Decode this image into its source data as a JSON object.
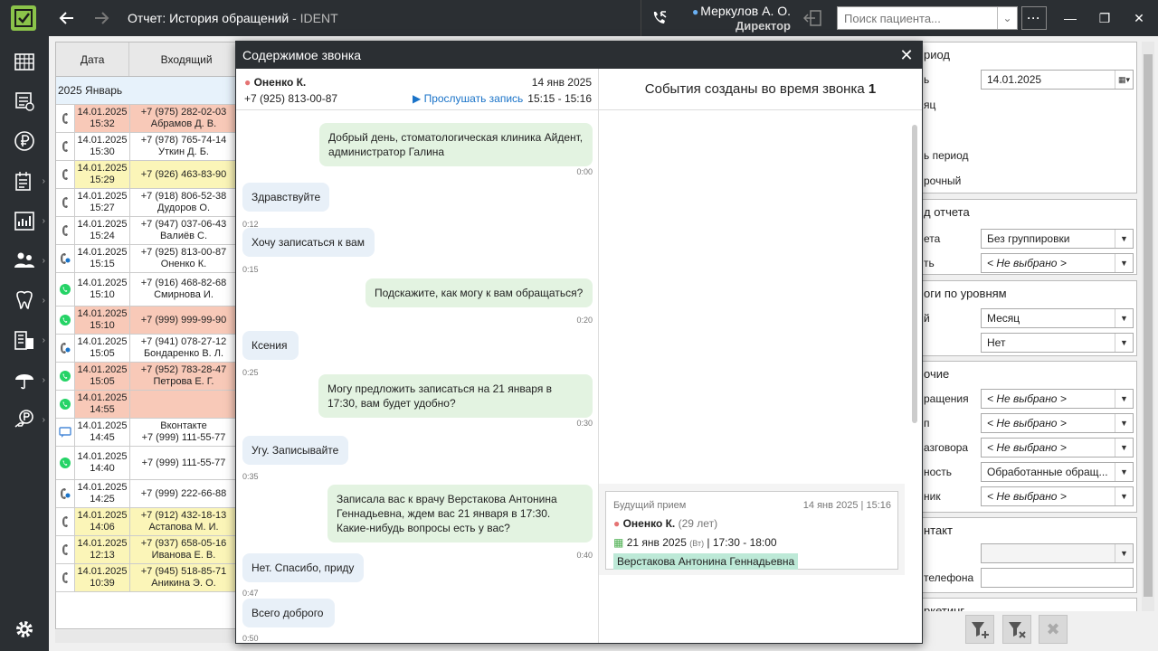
{
  "topbar": {
    "title": "Отчет: История обращений",
    "app_name": " - IDENT",
    "user_name": "Меркулов А. О.",
    "user_role": "Директор",
    "search_placeholder": "Поиск пациента...",
    "more_label": "···"
  },
  "table": {
    "col_date": "Дата",
    "col_incoming": "Входящий",
    "group_label": "2025 Январь",
    "rows": [
      {
        "date": "14.01.2025",
        "time": "15:32",
        "phone": "+7 (975) 282-02-03",
        "name": "Абрамов Д. В.",
        "status": "red",
        "icon": "phone"
      },
      {
        "date": "14.01.2025",
        "time": "15:30",
        "phone": "+7 (978) 765-74-14",
        "name": "Уткин Д. Б.",
        "status": "none",
        "icon": "phone"
      },
      {
        "date": "14.01.2025",
        "time": "15:29",
        "phone": "+7 (926) 463-83-90",
        "name": "",
        "status": "yellow",
        "icon": "phone"
      },
      {
        "date": "14.01.2025",
        "time": "15:27",
        "phone": "+7 (918) 806-52-38",
        "name": "Дудоров О.",
        "status": "none",
        "icon": "phone"
      },
      {
        "date": "14.01.2025",
        "time": "15:24",
        "phone": "+7 (947) 037-06-43",
        "name": "Валиёв С.",
        "status": "none",
        "icon": "phone"
      },
      {
        "date": "14.01.2025",
        "time": "15:15",
        "phone": "+7 (925) 813-00-87",
        "name": "Оненко К.",
        "status": "none",
        "icon": "phone-recorded"
      },
      {
        "date": "14.01.2025",
        "time": "15:10",
        "phone": "+7 (916) 468-82-68",
        "name": "Смирнова И.",
        "status": "none",
        "icon": "whatsapp"
      },
      {
        "date": "14.01.2025",
        "time": "15:10",
        "phone": "+7 (999) 999-99-90",
        "name": "",
        "status": "red",
        "icon": "whatsapp"
      },
      {
        "date": "14.01.2025",
        "time": "15:05",
        "phone": "+7 (941) 078-27-12",
        "name": "Бондаренко В. Л.",
        "status": "none",
        "icon": "phone-recorded"
      },
      {
        "date": "14.01.2025",
        "time": "15:05",
        "phone": "+7 (952) 783-28-47",
        "name": "Петрова Е. Г.",
        "status": "red",
        "icon": "whatsapp"
      },
      {
        "date": "14.01.2025",
        "time": "14:55",
        "phone": "",
        "name": "",
        "status": "red",
        "icon": "whatsapp"
      },
      {
        "date": "14.01.2025",
        "time": "14:45",
        "phone": "Вконтакте",
        "name": "+7 (999) 111-55-77",
        "status": "none",
        "icon": "chat"
      },
      {
        "date": "14.01.2025",
        "time": "14:40",
        "phone": "+7 (999) 111-55-77",
        "name": "",
        "status": "none",
        "icon": "whatsapp"
      },
      {
        "date": "14.01.2025",
        "time": "14:25",
        "phone": "+7 (999) 222-66-88",
        "name": "",
        "status": "none",
        "icon": "phone-recorded"
      },
      {
        "date": "14.01.2025",
        "time": "14:06",
        "phone": "+7 (912) 432-18-13",
        "name": "Астапова М. И.",
        "status": "yellow",
        "icon": "phone"
      },
      {
        "date": "14.01.2025",
        "time": "12:13",
        "phone": "+7 (937) 658-05-16",
        "name": "Иванова Е. В.",
        "status": "yellow",
        "icon": "phone"
      },
      {
        "date": "14.01.2025",
        "time": "10:39",
        "phone": "+7 (945) 518-85-71",
        "name": "Аникина Э. О.",
        "status": "yellow",
        "icon": "phone"
      }
    ]
  },
  "filters": {
    "period_header": "риод",
    "period_label": "ь",
    "period_value": "14.01.2025",
    "month_label": "яц",
    "custom_label": "ь период",
    "urgent_label": "рочный",
    "view_header": "д отчета",
    "view_group_label": "ета",
    "view_group_value": "Без группировки",
    "view_second_label": "ть",
    "view_second_value": "< Не выбрано >",
    "levels_header": "оги по уровням",
    "level1_label": "й",
    "level1_value": "Месяц",
    "level2_value": "Нет",
    "other_header": "очие",
    "f1_label": "ращения",
    "f1_value": "< Не выбрано >",
    "f2_label": "п",
    "f2_value": "< Не выбрано >",
    "f3_label": "азговора",
    "f3_value": "< Не выбрано >",
    "f4_label": "ность",
    "f4_value": "Обработанные обращ...",
    "f5_label": "ник",
    "f5_value": "< Не выбрано >",
    "contact_header": "нтакт",
    "contact_phone_label": "телефона",
    "marketing_header": "ркетинг"
  },
  "dialog": {
    "title": "Содержимое звонка",
    "caller_name": "Оненко К.",
    "caller_phone": "+7 (925) 813-00-87",
    "call_date": "14 янв 2025",
    "call_time": "15:15 - 15:16",
    "listen_label": "Прослушать запись",
    "events_title": "События созданы во время звонка",
    "events_count": "1",
    "messages": [
      {
        "side": "out",
        "text": "Добрый день, стоматологическая клиника Айдент, администратор Галина",
        "ts": "0:00"
      },
      {
        "side": "in",
        "text": "Здравствуйте",
        "ts": "0:12"
      },
      {
        "side": "in",
        "text": "Хочу записаться к вам",
        "ts": "0:15"
      },
      {
        "side": "out",
        "text": "Подскажите, как могу к вам обращаться?",
        "ts": "0:20"
      },
      {
        "side": "in",
        "text": "Ксения",
        "ts": "0:25"
      },
      {
        "side": "out",
        "text": "Могу предложить записаться на 21 января в 17:30, вам будет удобно?",
        "ts": "0:30"
      },
      {
        "side": "in",
        "text": "Угу. Записывайте",
        "ts": "0:35"
      },
      {
        "side": "out",
        "text": "Записала вас к врачу Верстакова Антонина Геннадьевна, ждем вас 21 января в 17:30. Какие-нибудь вопросы есть у вас?",
        "ts": "0:40"
      },
      {
        "side": "in",
        "text": "Нет. Спасибо, приду",
        "ts": "0:47"
      },
      {
        "side": "in",
        "text": "Всего доброго",
        "ts": "0:50"
      }
    ],
    "event": {
      "kind": "Будущий прием",
      "created": "14 янв 2025 | 15:16",
      "patient": "Оненко К.",
      "age": "(29 лет)",
      "visit_date": "21 янв 2025",
      "visit_dow": "(Вт)",
      "visit_time": "| 17:30 - 18:00",
      "doctor": "Верстакова Антонина Геннадьевна"
    }
  },
  "colors": {
    "dark": "#2b2f33",
    "accent_green": "#8bc34a",
    "row_red": "#f8c9b8",
    "row_yellow": "#fbf5b8",
    "msg_out": "#e3f3e1",
    "msg_in": "#e8f0f8",
    "link_blue": "#1a73c8"
  }
}
